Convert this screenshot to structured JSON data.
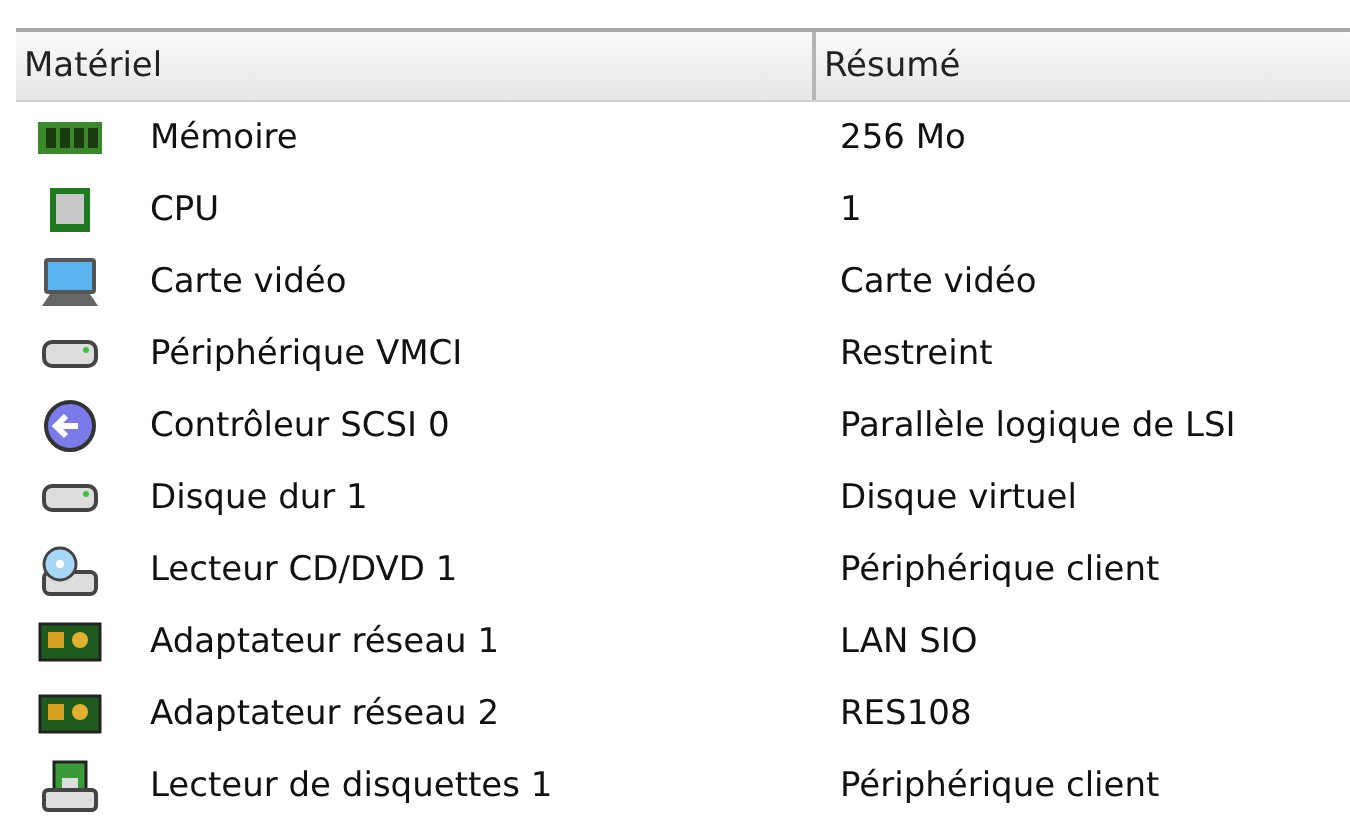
{
  "table": {
    "columns": [
      "Matériel",
      "Résumé"
    ],
    "rows": [
      {
        "kind": "memory",
        "name": "Mémoire",
        "summary": "256 Mo"
      },
      {
        "kind": "cpu",
        "name": "CPU",
        "summary": "1"
      },
      {
        "kind": "display",
        "name": "Carte vidéo",
        "summary": "Carte vidéo"
      },
      {
        "kind": "drive",
        "name": "Périphérique VMCI",
        "summary": "Restreint"
      },
      {
        "kind": "controller",
        "name": "Contrôleur SCSI 0",
        "summary": "Parallèle logique de LSI"
      },
      {
        "kind": "drive",
        "name": "Disque dur 1",
        "summary": "Disque virtuel"
      },
      {
        "kind": "cdrom",
        "name": "Lecteur CD/DVD 1",
        "summary": "Périphérique client"
      },
      {
        "kind": "network",
        "name": "Adaptateur réseau 1",
        "summary": "LAN SIO"
      },
      {
        "kind": "network",
        "name": "Adaptateur réseau 2",
        "summary": "RES108"
      },
      {
        "kind": "floppy",
        "name": "Lecteur de disquettes 1",
        "summary": "Périphérique client"
      }
    ]
  }
}
